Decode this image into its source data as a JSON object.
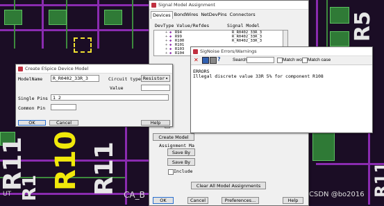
{
  "pcb": {
    "refdes_large": [
      "R11",
      "R10",
      "R11",
      "R1",
      "R5",
      "R11"
    ],
    "refdes_small": [
      "UT",
      "CA_B"
    ],
    "watermark": "CSDN @bo2016"
  },
  "assign_window": {
    "title": "Signal Model Assignment",
    "tabs": [
      "Devices",
      "BondWires",
      "NetDevPins",
      "Connectors"
    ],
    "col_headers": {
      "devtype": "DevType Value/Refdes",
      "model": "Signal Model"
    },
    "rows": [
      {
        "refdes": "R94",
        "model": "R_R0402_33R_3"
      },
      {
        "refdes": "R99",
        "model": "R_R0402_33R_3"
      },
      {
        "refdes": "R100",
        "model": "R_R0402_33R_3"
      },
      {
        "refdes": "R101",
        "model": ""
      },
      {
        "refdes": "R103",
        "model": ""
      },
      {
        "refdes": "R104",
        "model": ""
      },
      {
        "refdes": "R105",
        "model": ""
      },
      {
        "refdes": "R106",
        "model": ""
      }
    ],
    "create_model_label": "Create Model",
    "assignment_label": "Assignment Ma",
    "save_by_1": "Save By",
    "save_by_2": "Save By",
    "include_label": "Include",
    "clear_all_label": "Clear All Model Assignments",
    "ok_label": "OK",
    "cancel_label": "Cancel",
    "preferences_label": "Preferences...",
    "help_label": "Help"
  },
  "espice_window": {
    "title": "Create ESpice Device Model",
    "model_name_label": "ModelName",
    "model_name_value": "R_R0402_33R_3",
    "circuit_type_label": "Circuit type",
    "circuit_type_value": "Resistor",
    "value_label": "Value",
    "value_value": "",
    "single_pins_label": "Single Pins",
    "single_pins_value": "1 2",
    "common_pin_label": "Common Pin",
    "common_pin_value": "",
    "ok_label": "OK",
    "cancel_label": "Cancel",
    "help_label": "Help"
  },
  "errors_window": {
    "title": "SigNoise Errors/Warnings",
    "search_label": "Search:",
    "search_value": "",
    "match_word_label": "Match word",
    "match_case_label": "Match case",
    "heading": "ERRORS",
    "message": "Illegal discrete value 33R 5% for component R108"
  }
}
